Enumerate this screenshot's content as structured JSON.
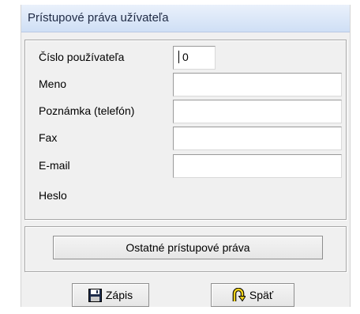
{
  "window": {
    "title": "Prístupové práva užívateľa"
  },
  "form": {
    "user_number_label": "Číslo používateľa",
    "user_number_value": "0",
    "name_label": "Meno",
    "name_value": "",
    "note_label": "Poznámka (telefón)",
    "note_value": "",
    "fax_label": "Fax",
    "fax_value": "",
    "email_label": "E-mail",
    "email_value": "",
    "password_label": "Heslo"
  },
  "buttons": {
    "other_rights": "Ostatné prístupové práva",
    "save": "Zápis",
    "back": "Späť"
  },
  "icons": {
    "save": "floppy-disk-icon",
    "back": "u-turn-arrow-icon"
  }
}
